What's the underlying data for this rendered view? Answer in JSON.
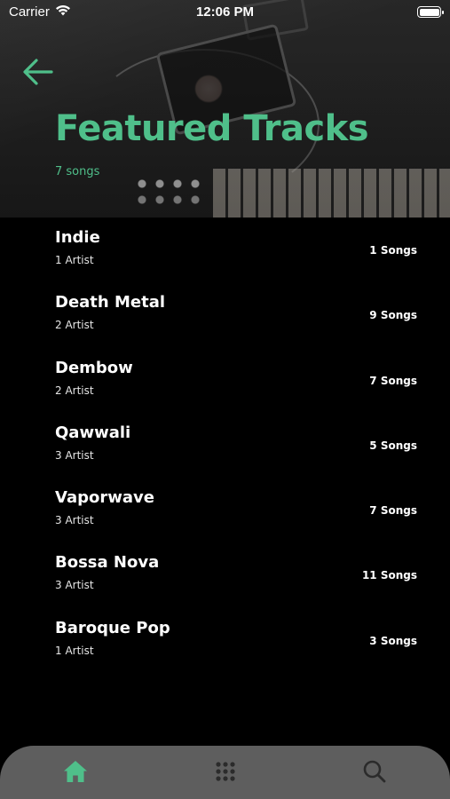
{
  "status_bar": {
    "carrier": "Carrier",
    "time": "12:06 PM"
  },
  "header": {
    "title": "Featured Tracks",
    "subtitle": "7 songs",
    "accent_color": "#4fbf8a",
    "back_icon": "arrow-left-icon"
  },
  "tracks": [
    {
      "name": "Indie",
      "artists": "1 Artist",
      "songs": "1 Songs"
    },
    {
      "name": "Death Metal",
      "artists": "2 Artist",
      "songs": "9 Songs"
    },
    {
      "name": "Dembow",
      "artists": "2 Artist",
      "songs": "7 Songs"
    },
    {
      "name": "Qawwali",
      "artists": "3 Artist",
      "songs": "5 Songs"
    },
    {
      "name": "Vaporwave",
      "artists": "3 Artist",
      "songs": "7 Songs"
    },
    {
      "name": "Bossa Nova",
      "artists": "3 Artist",
      "songs": "11 Songs"
    },
    {
      "name": "Baroque Pop",
      "artists": "1 Artist",
      "songs": "3 Songs"
    }
  ],
  "tab_bar": {
    "background": "#5e5e5e",
    "active_color": "#4fbf8a",
    "inactive_color": "#2b2b2b",
    "tabs": [
      {
        "icon": "home-icon",
        "active": true
      },
      {
        "icon": "grid-icon",
        "active": false
      },
      {
        "icon": "search-icon",
        "active": false
      }
    ]
  }
}
